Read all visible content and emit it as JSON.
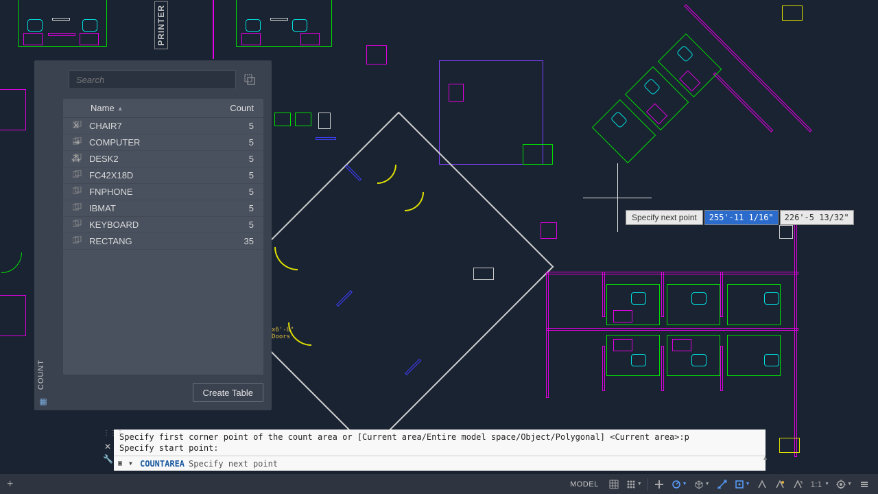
{
  "panel": {
    "tab_label": "COUNT",
    "search_placeholder": "Search",
    "headers": {
      "name": "Name",
      "count": "Count"
    },
    "rows": [
      {
        "name": "CHAIR7",
        "count": "5"
      },
      {
        "name": "COMPUTER",
        "count": "5"
      },
      {
        "name": "DESK2",
        "count": "5"
      },
      {
        "name": "FC42X18D",
        "count": "5"
      },
      {
        "name": "FNPHONE",
        "count": "5"
      },
      {
        "name": "IBMAT",
        "count": "5"
      },
      {
        "name": "KEYBOARD",
        "count": "5"
      },
      {
        "name": "RECTANG",
        "count": "35"
      }
    ],
    "create_table_label": "Create Table"
  },
  "canvas_labels": {
    "printer": "PRINTER",
    "doors_note": "x6'-8\"\nDoors"
  },
  "dynamic_input": {
    "label": "Specify next point",
    "value1": "255'-11 1/16\"",
    "value2": "226'-5 13/32\""
  },
  "command": {
    "history_line1": "Specify first corner point of the count area or [Current area/Entire model space/Object/Polygonal] <Current area>:p",
    "history_line2": "Specify start point:",
    "active_command": "COUNTAREA",
    "prompt_text": "Specify next point"
  },
  "status": {
    "model_label": "MODEL",
    "scale_label": "1:1"
  },
  "colors": {
    "bg": "#1a2332",
    "panel_bg": "#3a424f",
    "magenta": "#e000e0",
    "cyan": "#00e0e0",
    "green": "#00e000",
    "yellow": "#e0e000",
    "accent": "#5aa0ff"
  }
}
